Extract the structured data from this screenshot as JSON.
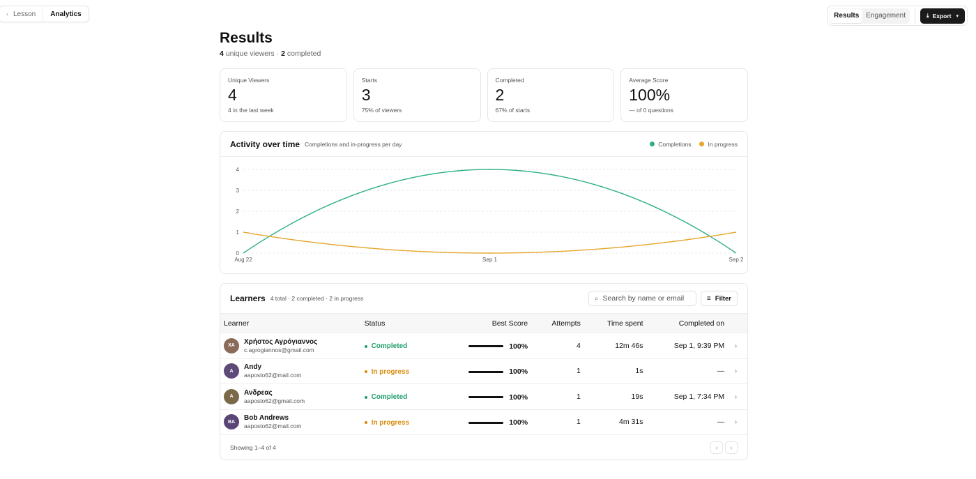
{
  "nav": {
    "back_label": "Lesson",
    "current_label": "Analytics"
  },
  "view_toggle": {
    "results_label": "Results",
    "engagement_label": "Engagement",
    "export_label": "Export"
  },
  "header": {
    "title": "Results",
    "viewers_count": "4",
    "viewers_label": "unique viewers ·",
    "completed_count": "2",
    "completed_label": "completed"
  },
  "stats": [
    {
      "label": "Unique Viewers",
      "value": "4",
      "sub": "4 in the last week"
    },
    {
      "label": "Starts",
      "value": "3",
      "sub": "75% of viewers"
    },
    {
      "label": "Completed",
      "value": "2",
      "sub": "67% of starts"
    },
    {
      "label": "Average Score",
      "value": "100%",
      "sub": "— of 0 questions"
    }
  ],
  "activity": {
    "title": "Activity over time",
    "description": "Completions and in-progress per day",
    "legend": [
      {
        "name": "Completions",
        "color": "#2eaf82"
      },
      {
        "name": "In progress",
        "color": "#e6a52b"
      }
    ]
  },
  "chart_data": {
    "type": "line",
    "x": [
      "Aug 22",
      "Sep 1",
      "Sep 2"
    ],
    "series": [
      {
        "name": "Completions",
        "values": [
          0,
          4,
          0
        ],
        "color": "#2eaf82"
      },
      {
        "name": "In progress",
        "values": [
          1,
          0,
          1
        ],
        "color": "#e6a52b"
      }
    ],
    "ylim": [
      0,
      4
    ],
    "yticks": [
      0,
      1,
      2,
      3,
      4
    ],
    "grid": true,
    "smooth": true,
    "legend_position": "top-right"
  },
  "learners": {
    "title": "Learners",
    "summary": "4 total · 2 completed · 2 in progress",
    "search_placeholder": "Search by name or email",
    "filter_label": "Filter",
    "columns": [
      "Learner",
      "Status",
      "Best Score",
      "Attempts",
      "Time spent",
      "Completed on"
    ],
    "rows": [
      {
        "initials": "XA",
        "avatar_color": "#8a6a58",
        "name": "Χρήστος Αγρόγιαννος",
        "email": "c.agrogiannos@gmail.com",
        "status": "Completed",
        "status_color": "#1f9d6b",
        "score": "100%",
        "score_fraction": 1.0,
        "attempts": "4",
        "time": "12m 46s",
        "completed_on": "Sep 1, 9:39 PM"
      },
      {
        "initials": "A",
        "avatar_color": "#5e4a78",
        "name": "Andy",
        "email": "aaposto62@mail.com",
        "status": "In progress",
        "status_color": "#d98a0b",
        "score": "100%",
        "score_fraction": 1.0,
        "attempts": "1",
        "time": "1s",
        "completed_on": "—"
      },
      {
        "initials": "A",
        "avatar_color": "#7a6848",
        "name": "Ανδρεας",
        "email": "aaposto62@gmail.com",
        "status": "Completed",
        "status_color": "#1f9d6b",
        "score": "100%",
        "score_fraction": 1.0,
        "attempts": "1",
        "time": "19s",
        "completed_on": "Sep 1, 7:34 PM"
      },
      {
        "initials": "BA",
        "avatar_color": "#5b4576",
        "name": "Bob Andrews",
        "email": "aaposto62@mail.com",
        "status": "In progress",
        "status_color": "#d98a0b",
        "score": "100%",
        "score_fraction": 1.0,
        "attempts": "1",
        "time": "4m 31s",
        "completed_on": "—"
      }
    ],
    "showing": "Showing 1–4 of 4"
  }
}
